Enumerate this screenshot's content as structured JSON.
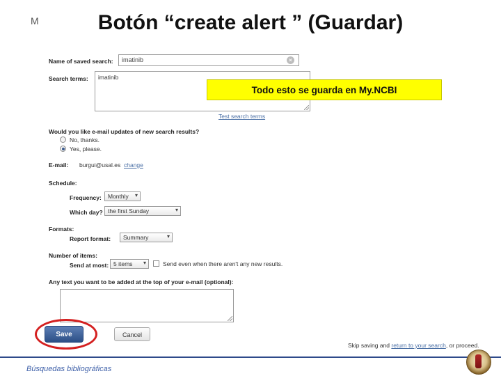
{
  "slide": {
    "corner_letter": "M",
    "title": "Botón “create alert ” (Guardar)",
    "footer_text": "Búsquedas bibliográficas"
  },
  "callout": {
    "text": "Todo esto se guarda en My.NCBI"
  },
  "form": {
    "saved_search_label": "Name of saved search:",
    "saved_search_value": "imatinib",
    "clear_icon": "×",
    "search_terms_label": "Search terms:",
    "search_terms_value": "imatinib",
    "test_search_terms_link": "Test search terms",
    "email_updates_label": "Would you like e-mail updates of new search results?",
    "radio_no_label": "No, thanks.",
    "radio_yes_label": "Yes, please.",
    "radio_selected": "yes",
    "email_label": "E-mail:",
    "email_value": "burgui@usal.es",
    "email_change_link": "change",
    "schedule_label": "Schedule:",
    "frequency_label": "Frequency:",
    "frequency_value": "Monthly",
    "which_day_label": "Which day?",
    "which_day_value": "the first Sunday",
    "formats_label": "Formats:",
    "report_format_label": "Report format:",
    "report_format_value": "Summary",
    "number_of_items_label": "Number of items:",
    "send_at_most_label": "Send at most:",
    "send_at_most_value": "5 items",
    "send_even_checkbox_label": "Send even when there aren't any new results.",
    "any_text_label": "Any text you want to be added at the top of your e-mail (optional):",
    "any_text_value": "",
    "save_button": "Save",
    "cancel_button": "Cancel",
    "skip_text_prefix": "Skip saving and ",
    "skip_text_link": "return to your search",
    "skip_text_suffix": ", or proceed."
  },
  "colors": {
    "highlight": "#ffff00",
    "save_button": "#2c4f86",
    "ellipse": "#d42020",
    "footer_rule": "#2e4a8a",
    "link": "#4a6fa5"
  }
}
